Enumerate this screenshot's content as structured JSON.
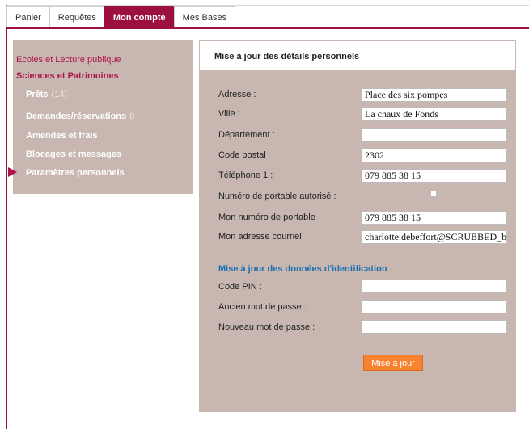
{
  "tabs": [
    {
      "label": "Panier"
    },
    {
      "label": "Requêtes"
    },
    {
      "label": "Mon compte",
      "active": true
    },
    {
      "label": "Mes Bases"
    }
  ],
  "sidebar": {
    "top_link": "Ecoles et Lecture publique",
    "section": "Sciences et Patrimoines",
    "items": [
      {
        "label": "Prêts",
        "count": "(14)"
      },
      {
        "label": "Demandes/réservations",
        "count": "0"
      },
      {
        "label": "Amendes et frais",
        "count": ""
      },
      {
        "label": "Blocages et messages",
        "count": ""
      },
      {
        "label": "Paramètres personnels",
        "count": "",
        "selected": true
      }
    ]
  },
  "form": {
    "title": "Mise à jour des détails personnels",
    "fields": [
      {
        "label": "Adresse :",
        "value": "Place des six pompes"
      },
      {
        "label": "Ville :",
        "value": "La chaux de Fonds"
      },
      {
        "label": "Département :",
        "value": ""
      },
      {
        "label": "Code postal",
        "value": "2302"
      },
      {
        "label": "Téléphone 1 :",
        "value": "079 885 38 15"
      },
      {
        "label": "Numéro de portable autorisé :",
        "value": ""
      },
      {
        "label": "Mon numéro de portable",
        "value": "079 885 38 15"
      },
      {
        "label": "Mon adresse courriel",
        "value": "charlotte.debeffort@SCRUBBED_b"
      }
    ],
    "id_section_title": "Mise à jour des données d'identification",
    "id_fields": [
      {
        "label": "Code PIN :",
        "value": ""
      },
      {
        "label": "Ancien mot de passe :",
        "value": ""
      },
      {
        "label": "Nouveau mot de passe :",
        "value": ""
      }
    ],
    "submit_label": "Mise à jour"
  },
  "colors": {
    "accent": "#9c1040",
    "panel": "#c7b7b0",
    "section_title": "#1a6fb0",
    "button": "#f7822f"
  }
}
